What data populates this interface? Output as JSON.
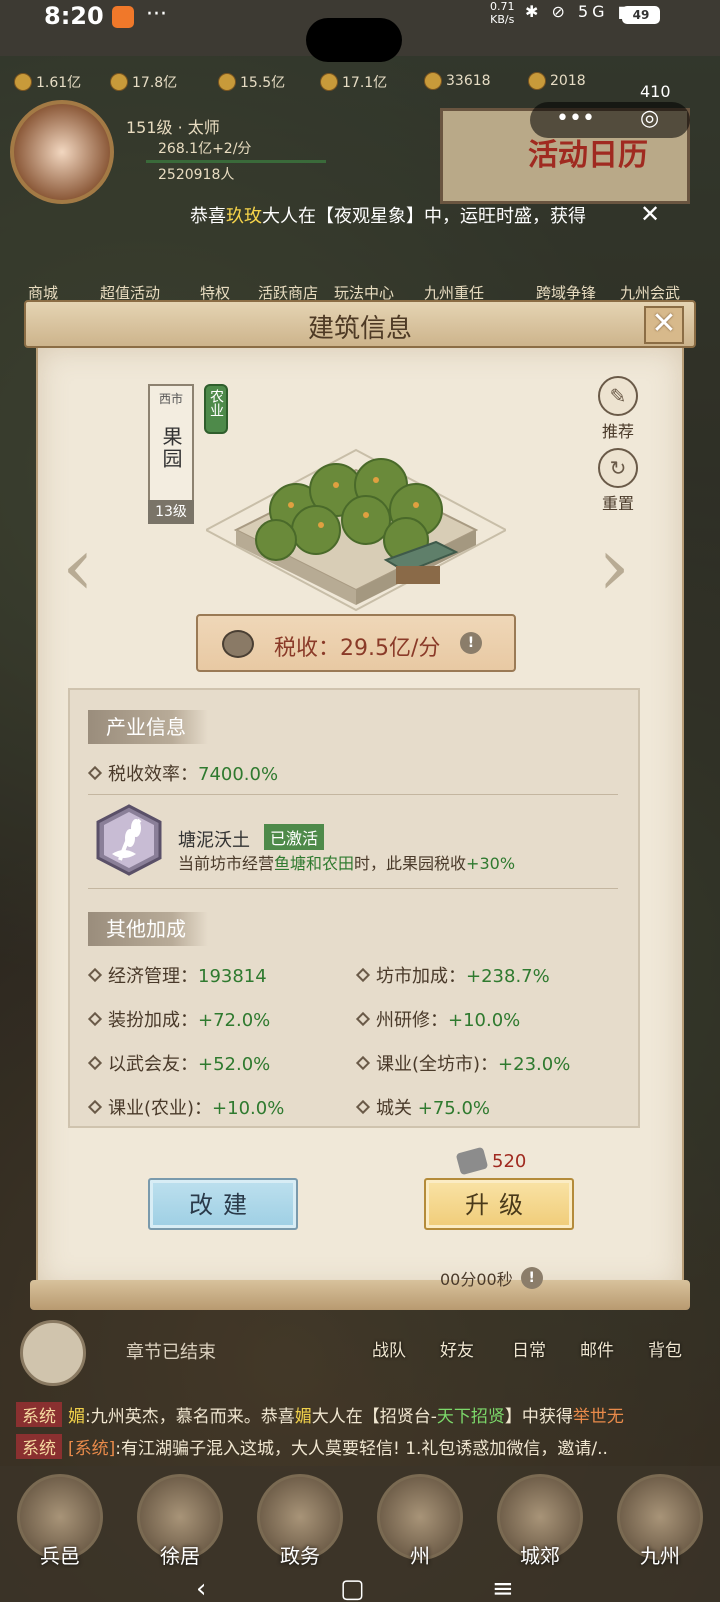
{
  "status_bar": {
    "time": "8:20",
    "more": "···",
    "net_speed": "0.71",
    "net_unit": "KB/s",
    "signal": "5G",
    "battery": "49"
  },
  "resources": [
    "1.61亿",
    "17.8亿",
    "15.5亿",
    "17.1亿",
    "33618",
    "2018"
  ],
  "player": {
    "level": "151级 · 太师",
    "income": "268.1亿+2/分",
    "population": "2520918人"
  },
  "event_banner": {
    "label": "活动日历",
    "count": "410"
  },
  "ticker": {
    "prefix": "恭喜",
    "name": "玖玫",
    "suffix": "大人在【夜观星象】中，运旺时盛，获得",
    "close": "✕"
  },
  "menu": [
    "商城",
    "超值活动",
    "特权",
    "活跃商店",
    "玩法中心",
    "九州重任",
    "跨域争锋",
    "九州会武"
  ],
  "modal": {
    "title": "建筑信息",
    "close": "✕",
    "building": {
      "district": "西市",
      "name": "果园",
      "level": "13级",
      "category": "农业"
    },
    "side_buttons": {
      "recommend": "推荐",
      "reset": "重置"
    },
    "tax": {
      "label": "税收：29.5亿/分"
    },
    "industry": {
      "title": "产业信息",
      "efficiency_label": "税收效率：",
      "efficiency_value": "7400.0%",
      "talent": {
        "name": "塘泥沃土",
        "status": "已激活",
        "desc_prefix": "当前坊市经营",
        "desc_highlight": "鱼塘和农田",
        "desc_mid": "时，此果园税收",
        "desc_bonus": "+30%"
      }
    },
    "other": {
      "title": "其他加成",
      "stats": [
        {
          "label": "经济管理：",
          "value": "193814"
        },
        {
          "label": "坊市加成：",
          "value": "+238.7%"
        },
        {
          "label": "装扮加成：",
          "value": "+72.0%"
        },
        {
          "label": "州研修：",
          "value": "+10.0%"
        },
        {
          "label": "以武会友：",
          "value": "+52.0%"
        },
        {
          "label": "课业(全坊市)：",
          "value": "+23.0%"
        },
        {
          "label": "课业(农业)：",
          "value": "+10.0%"
        },
        {
          "label": "城关",
          "value": "+75.0%"
        }
      ]
    },
    "cost": "520",
    "rebuild_btn": "改建",
    "upgrade_btn": "升级",
    "timer": "00分00秒"
  },
  "chapter": "章节已结束",
  "social": [
    "战队",
    "好友",
    "日常",
    "邮件",
    "背包"
  ],
  "chat": [
    {
      "tag": "系统",
      "text_a": "媚",
      "text_b": ":九州英杰，慕名而来。恭喜",
      "text_c": "媚",
      "text_d": "大人在【招贤台-",
      "text_e": "天下招贤",
      "text_f": "】中获得",
      "text_g": "举世无"
    },
    {
      "tag": "系统",
      "text_a": "[系统]",
      "text_b": ":有江湖骗子混入这城，大人莫要轻信! 1.礼包诱惑加微信，邀请/.."
    }
  ],
  "bottom_nav": [
    "兵邑",
    "徐居",
    "政务",
    "州",
    "城郊",
    "九州"
  ],
  "nav_bar": {
    "back": "‹",
    "home": "▢",
    "recent": "≡"
  }
}
